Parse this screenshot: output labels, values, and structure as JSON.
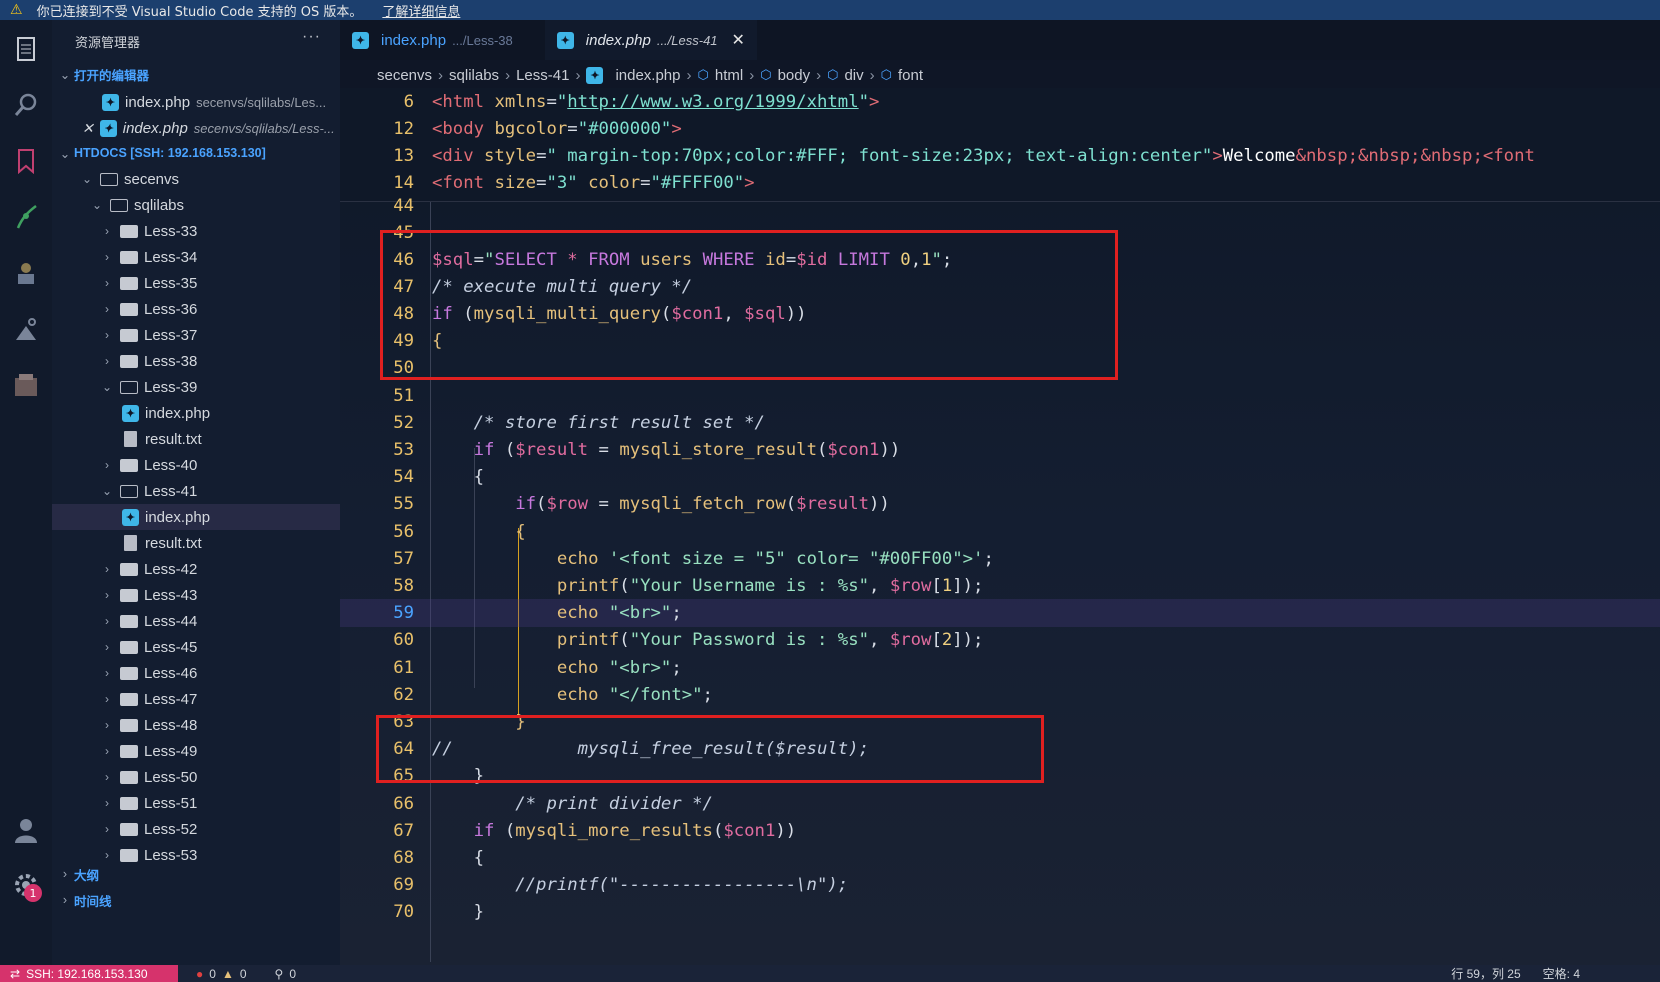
{
  "notification": {
    "message": "你已连接到不受 Visual Studio Code 支持的 OS 版本。",
    "link": "了解详细信息"
  },
  "activity_bar": {
    "icons": [
      "explorer-icon",
      "search-icon",
      "bookmark-icon",
      "source-control-icon",
      "extensions-icon",
      "remote-icon",
      "database-icon",
      "account-icon",
      "settings-icon"
    ],
    "settings_badge": "1"
  },
  "sidebar": {
    "title": "资源管理器",
    "more": "···",
    "open_editors_header": "打开的编辑器",
    "open_editors": [
      {
        "name": "index.php",
        "path": "secenvs/sqlilabs/Les..."
      },
      {
        "name": "index.php",
        "path": "secenvs/sqlilabs/Less-..."
      }
    ],
    "workspace_header": "HTDOCS [SSH: 192.168.153.130]",
    "tree": [
      {
        "label": "secenvs"
      },
      {
        "label": "sqlilabs"
      },
      {
        "label": "Less-33"
      },
      {
        "label": "Less-34"
      },
      {
        "label": "Less-35"
      },
      {
        "label": "Less-36"
      },
      {
        "label": "Less-37"
      },
      {
        "label": "Less-38"
      },
      {
        "label": "Less-39"
      },
      {
        "label": "index.php"
      },
      {
        "label": "result.txt"
      },
      {
        "label": "Less-40"
      },
      {
        "label": "Less-41"
      },
      {
        "label": "index.php"
      },
      {
        "label": "result.txt"
      },
      {
        "label": "Less-42"
      },
      {
        "label": "Less-43"
      },
      {
        "label": "Less-44"
      },
      {
        "label": "Less-45"
      },
      {
        "label": "Less-46"
      },
      {
        "label": "Less-47"
      },
      {
        "label": "Less-48"
      },
      {
        "label": "Less-49"
      },
      {
        "label": "Less-50"
      },
      {
        "label": "Less-51"
      },
      {
        "label": "Less-52"
      },
      {
        "label": "Less-53"
      }
    ],
    "outline_header": "大纲",
    "timeline_header": "时间线"
  },
  "tabs": [
    {
      "name": "index.php",
      "path": ".../Less-38"
    },
    {
      "name": "index.php",
      "path": ".../Less-41",
      "close": "✕"
    }
  ],
  "breadcrumb": [
    "secenvs",
    "sqlilabs",
    "Less-41",
    "index.php",
    "html",
    "body",
    "div",
    "font"
  ],
  "editor": {
    "sticky_lines": [
      {
        "n": "6"
      },
      {
        "n": "12"
      },
      {
        "n": "13"
      },
      {
        "n": "14"
      }
    ],
    "line_numbers": [
      "44",
      "45",
      "46",
      "47",
      "48",
      "49",
      "50",
      "51",
      "52",
      "53",
      "54",
      "55",
      "56",
      "57",
      "58",
      "59",
      "60",
      "61",
      "62",
      "63",
      "64",
      "65",
      "66",
      "67",
      "68",
      "69",
      "70"
    ]
  },
  "status_bar": {
    "remote": "SSH: 192.168.153.130",
    "errors": "0",
    "warnings": "0",
    "ports": "0",
    "position": "行 59，列 25",
    "spaces": "空格: 4"
  }
}
